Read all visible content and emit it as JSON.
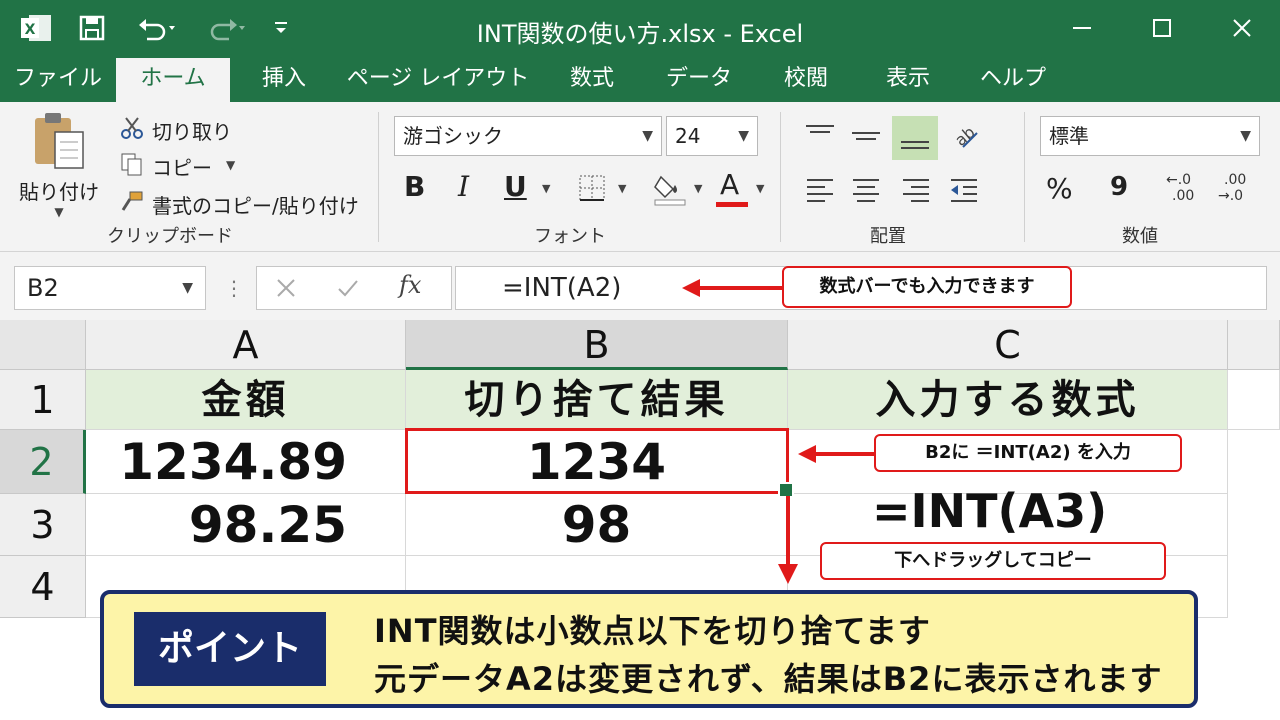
{
  "window": {
    "title": "INT関数の使い方.xlsx - Excel",
    "min_icon": "minimize-icon",
    "max_icon": "maximize-icon",
    "close_icon": "close-icon"
  },
  "quick_access": [
    "excel-logo-icon",
    "save-icon",
    "undo-icon",
    "redo-icon",
    "customize-icon"
  ],
  "tabs": [
    "ファイル",
    "ホーム",
    "挿入",
    "ページ レイアウト",
    "数式",
    "データ",
    "校閲",
    "表示",
    "ヘルプ"
  ],
  "active_tab": "ホーム",
  "ribbon": {
    "clipboard": {
      "paste": "貼り付け",
      "cut": "切り取り",
      "copy": "コピー",
      "format_painter": "書式のコピー/貼り付け",
      "label": "クリップボード"
    },
    "font": {
      "name": "游ゴシック",
      "size": "24",
      "bold": "B",
      "italic": "I",
      "underline": "U",
      "font_color_letter": "A",
      "label": "フォント"
    },
    "alignment": {
      "label": "配置"
    },
    "number": {
      "format": "標準",
      "percent": "%",
      "comma": "9",
      "inc_top": "←.0",
      "inc_bottom": ".00",
      "dec_top": ".00",
      "dec_bottom": "→.0",
      "label": "数値"
    }
  },
  "formula_bar": {
    "name_box": "B2",
    "fx": "fx",
    "formula": "=INT(A2)"
  },
  "grid": {
    "columns": [
      "A",
      "B",
      "C"
    ],
    "rows": [
      "1",
      "2",
      "3",
      "4"
    ],
    "header_row": [
      "金額",
      "切り捨て結果",
      "入力する数式"
    ],
    "data": [
      {
        "a": "1234.89",
        "b": "1234"
      },
      {
        "a": "98.25",
        "b": "98"
      }
    ],
    "c3_formula": "=INT(A3)"
  },
  "annotations": {
    "formula_bar_note": "数式バーでも入力できます",
    "b2_note": "B2に ＝INT(A2) を入力",
    "drag_note": "下へドラッグしてコピー"
  },
  "point": {
    "badge": "ポイント",
    "line1": "INT関数は小数点以下を切り捨てます",
    "line2": "元データA2は変更されず、結果はB2に表示されます"
  },
  "colors": {
    "excel_green": "#217346",
    "header_fill": "#e2efda",
    "callout_red": "#e01a1a",
    "point_bg": "#fdf4a8",
    "point_border": "#1a2d6b"
  }
}
